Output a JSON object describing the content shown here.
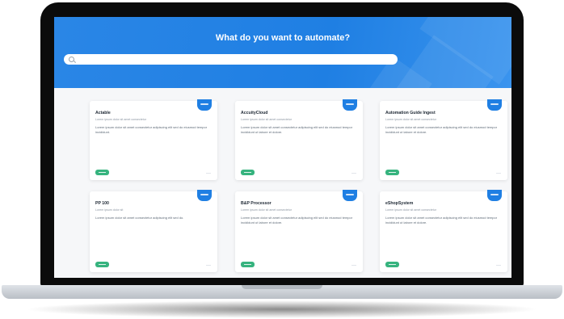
{
  "hero": {
    "title": "What do you want to automate?",
    "search_placeholder": "",
    "accent_color": "#1f7fe3"
  },
  "cards": [
    {
      "title": "Actable",
      "subtitle": "Lorem ipsum dolor sit amet consectetur",
      "description": "Lorem ipsum dolor sit amet consectetur adipiscing elit sed do eiusmod tempor incididunt."
    },
    {
      "title": "AccuityCloud",
      "subtitle": "Lorem ipsum dolor sit amet consectetur",
      "description": "Lorem ipsum dolor sit amet consectetur adipiscing elit sed do eiusmod tempor incididunt ut labore et dolore."
    },
    {
      "title": "Automation Guide Ingest",
      "subtitle": "Lorem ipsum dolor sit amet consectetur",
      "description": "Lorem ipsum dolor sit amet consectetur adipiscing elit sed do eiusmod tempor incididunt ut labore et dolore."
    },
    {
      "title": "PP 100",
      "subtitle": "Lorem ipsum dolor sit",
      "description": "Lorem ipsum dolor sit amet consectetur adipiscing elit sed do."
    },
    {
      "title": "B&P Processor",
      "subtitle": "Lorem ipsum dolor sit amet consectetur",
      "description": "Lorem ipsum dolor sit amet consectetur adipiscing elit sed do eiusmod tempor incididunt ut labore et dolore."
    },
    {
      "title": "eShopSystem",
      "subtitle": "Lorem ipsum dolor sit amet consectetur",
      "description": "Lorem ipsum dolor sit amet consectetur adipiscing elit sed do eiusmod tempor incididunt ut labore et dolore."
    }
  ]
}
